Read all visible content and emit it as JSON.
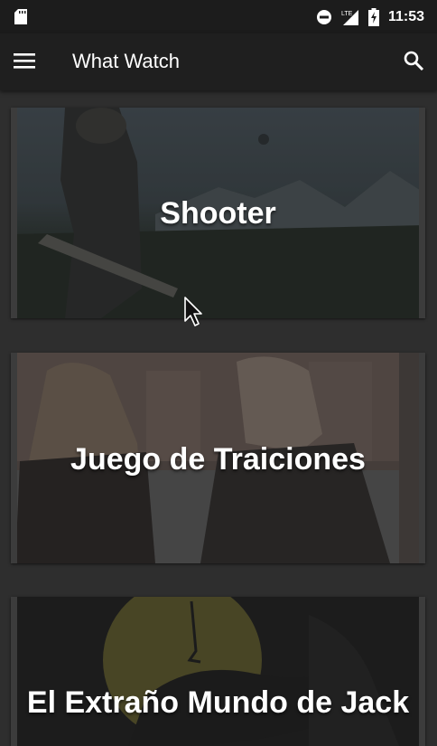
{
  "status_bar": {
    "time": "11:53",
    "network_label": "LTE"
  },
  "app_bar": {
    "title": "What Watch"
  },
  "movies": [
    {
      "title": "Shooter"
    },
    {
      "title": "Juego de Traiciones"
    },
    {
      "title": "El Extraño Mundo de Jack"
    }
  ],
  "colors": {
    "background": "#2e2e2e",
    "app_bar": "#1f1f1f",
    "status_bar": "#1c1c1c",
    "text": "#ffffff"
  },
  "icons": [
    "sd-card-icon",
    "do-not-disturb-icon",
    "lte-signal-icon",
    "battery-charging-icon",
    "menu-icon",
    "search-icon",
    "mouse-cursor-icon"
  ]
}
